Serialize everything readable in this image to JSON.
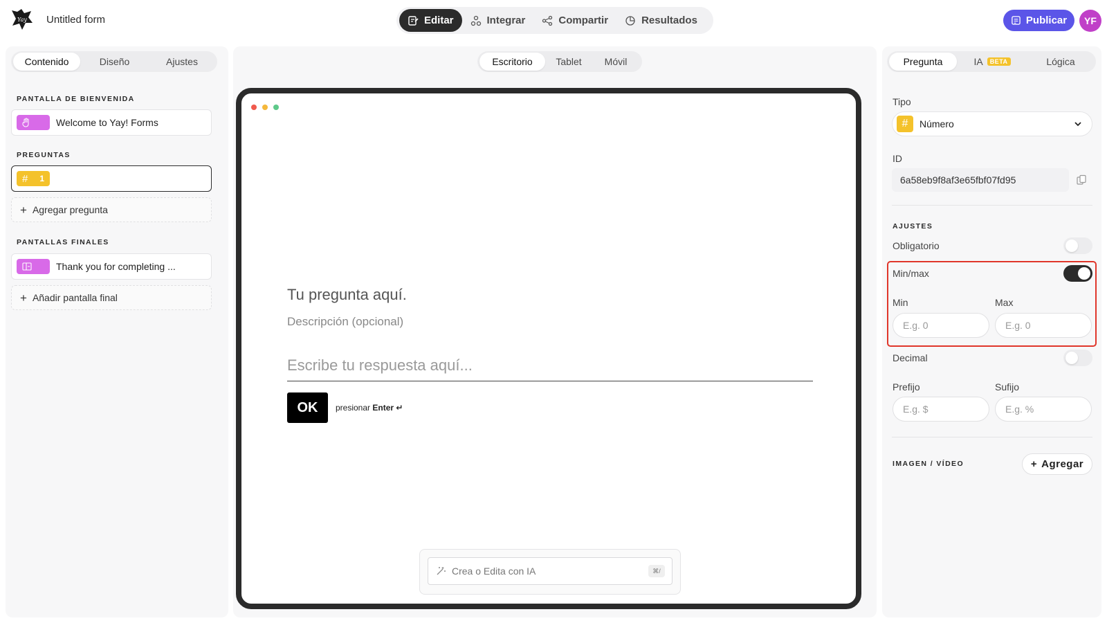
{
  "app": {
    "form_title": "Untitled form",
    "avatar_initials": "YF",
    "publish_label": "Publicar",
    "accent_color": "#5b55e8"
  },
  "main_tabs": [
    {
      "label": "Editar",
      "icon": "edit-icon",
      "active": true
    },
    {
      "label": "Integrar",
      "icon": "integrate-icon",
      "active": false
    },
    {
      "label": "Compartir",
      "icon": "share-icon",
      "active": false
    },
    {
      "label": "Resultados",
      "icon": "results-icon",
      "active": false
    }
  ],
  "left_panel": {
    "tabs": [
      "Contenido",
      "Diseño",
      "Ajustes"
    ],
    "active_tab": "Contenido",
    "welcome_section": "PANTALLA DE BIENVENIDA",
    "welcome_item": "Welcome to Yay! Forms",
    "questions_section": "PREGUNTAS",
    "question_item_number": "1",
    "add_question": "Agregar pregunta",
    "endings_section": "PANTALLAS FINALES",
    "ending_item": "Thank you for completing ...",
    "add_ending": "Añadir pantalla final"
  },
  "center": {
    "device_tabs": [
      "Escritorio",
      "Tablet",
      "Móvil"
    ],
    "active_device": "Escritorio",
    "question_title": "Tu pregunta aquí.",
    "question_desc": "Descripción (opcional)",
    "answer_placeholder": "Escribe tu respuesta aquí...",
    "ok_label": "OK",
    "press_hint": "presionar",
    "press_key": "Enter ↵",
    "ai_placeholder": "Crea o Edita con IA",
    "ai_shortcut": "⌘/"
  },
  "right_panel": {
    "tabs": [
      "Pregunta",
      "IA",
      "Lógica"
    ],
    "beta_label": "BETA",
    "active_tab": "Pregunta",
    "type_label": "Tipo",
    "type_value": "Número",
    "id_label": "ID",
    "id_value": "6a58eb9f8af3e65fbf07fd95",
    "settings_section": "AJUSTES",
    "required_label": "Obligatorio",
    "required_on": false,
    "minmax_label": "Min/max",
    "minmax_on": true,
    "min_label": "Min",
    "min_placeholder": "E.g. 0",
    "max_label": "Max",
    "max_placeholder": "E.g. 0",
    "decimal_label": "Decimal",
    "decimal_on": false,
    "prefix_label": "Prefijo",
    "prefix_placeholder": "E.g. $",
    "suffix_label": "Sufijo",
    "suffix_placeholder": "E.g. %",
    "media_section": "IMAGEN / VÍDEO",
    "add_media": "Agregar"
  }
}
